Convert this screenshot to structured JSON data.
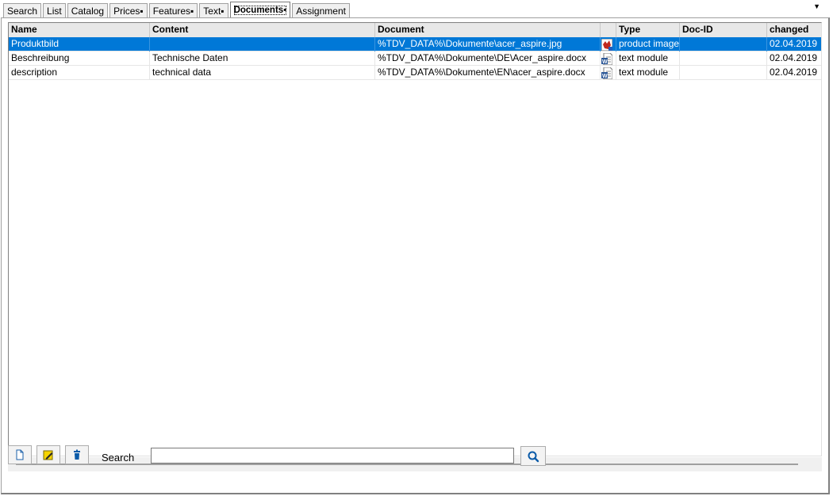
{
  "tabs": [
    {
      "label": "Search"
    },
    {
      "label": "List"
    },
    {
      "label": "Catalog"
    },
    {
      "label": "Prices▪"
    },
    {
      "label": "Features▪"
    },
    {
      "label": "Text▪"
    },
    {
      "label": "Documents▪",
      "active": true
    },
    {
      "label": "Assignment"
    }
  ],
  "grid": {
    "columns": [
      "Name",
      "Content",
      "Document",
      "",
      "Type",
      "Doc-ID",
      "changed"
    ],
    "rows": [
      {
        "name": "Produktbild",
        "content": "",
        "document": "%TDV_DATA%\\Dokumente\\acer_aspire.jpg",
        "icon": "image-file-icon",
        "type": "product image",
        "docid": "",
        "changed": "02.04.2019",
        "selected": true
      },
      {
        "name": "Beschreibung",
        "content": "Technische Daten",
        "document": "%TDV_DATA%\\Dokumente\\DE\\Acer_aspire.docx",
        "icon": "word-file-icon",
        "type": "text module",
        "docid": "",
        "changed": "02.04.2019"
      },
      {
        "name": "description",
        "content": "technical data",
        "document": "%TDV_DATA%\\Dokumente\\EN\\acer_aspire.docx",
        "icon": "word-file-icon",
        "type": "text module",
        "docid": "",
        "changed": "02.04.2019"
      }
    ]
  },
  "toolbar": {
    "new_icon": "new-document-icon",
    "edit_icon": "edit-icon",
    "delete_icon": "trash-icon",
    "search_label": "Search",
    "search_value": "",
    "search_icon": "magnifier-icon"
  },
  "colors": {
    "selection": "#0078d7",
    "accent": "#0a5aa8"
  }
}
